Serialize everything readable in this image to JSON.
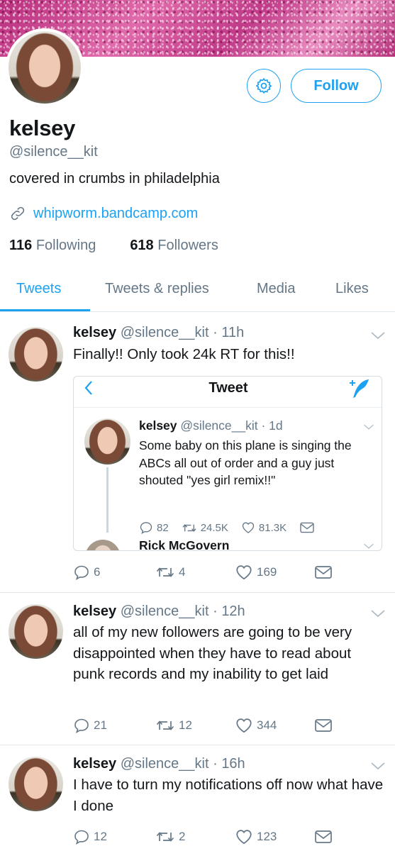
{
  "profile": {
    "name": "kelsey",
    "handle": "@silence__kit",
    "bio": "covered in crumbs in philadelphia",
    "website": "whipworm.bandcamp.com",
    "following_count": "116",
    "following_label": "Following",
    "followers_count": "618",
    "followers_label": "Followers",
    "follow_label": "Follow"
  },
  "tabs": [
    {
      "label": "Tweets",
      "active": true
    },
    {
      "label": "Tweets & replies"
    },
    {
      "label": "Media"
    },
    {
      "label": "Likes"
    }
  ],
  "tweets": [
    {
      "name": "kelsey",
      "meta": "@silence__kit · 11h",
      "text": "Finally!! Only took 24k RT for this!!",
      "replies": "6",
      "retweets": "4",
      "likes": "169",
      "embed": {
        "nav_title": "Tweet",
        "tweet": {
          "name": "kelsey",
          "meta": "@silence__kit · 1d",
          "text": "Some baby on this plane is singing the ABCs all out of order and a guy just shouted \"yes girl remix!!\"",
          "replies": "82",
          "retweets": "24.5K",
          "likes": "81.3K"
        },
        "next_reply_name": "Rick McGovern"
      }
    },
    {
      "name": "kelsey",
      "meta": "@silence__kit · 12h",
      "text": "all of my new followers are going to be very disappointed when they have to read about punk records and my inability to get laid",
      "replies": "21",
      "retweets": "12",
      "likes": "344"
    },
    {
      "name": "kelsey",
      "meta": "@silence__kit · 16h",
      "text": "I have to turn my notifications off now what have I done",
      "replies": "12",
      "retweets": "2",
      "likes": "123"
    }
  ],
  "colors": {
    "accent": "#1da1f2",
    "secondary_text": "#657786",
    "divider": "#e1e8ed",
    "banner": "#c93d8d"
  },
  "icons": [
    "gear-icon",
    "link-icon",
    "chevron-down-icon",
    "reply-icon",
    "retweet-icon",
    "heart-icon",
    "message-icon",
    "back-chevron-icon",
    "compose-icon"
  ]
}
